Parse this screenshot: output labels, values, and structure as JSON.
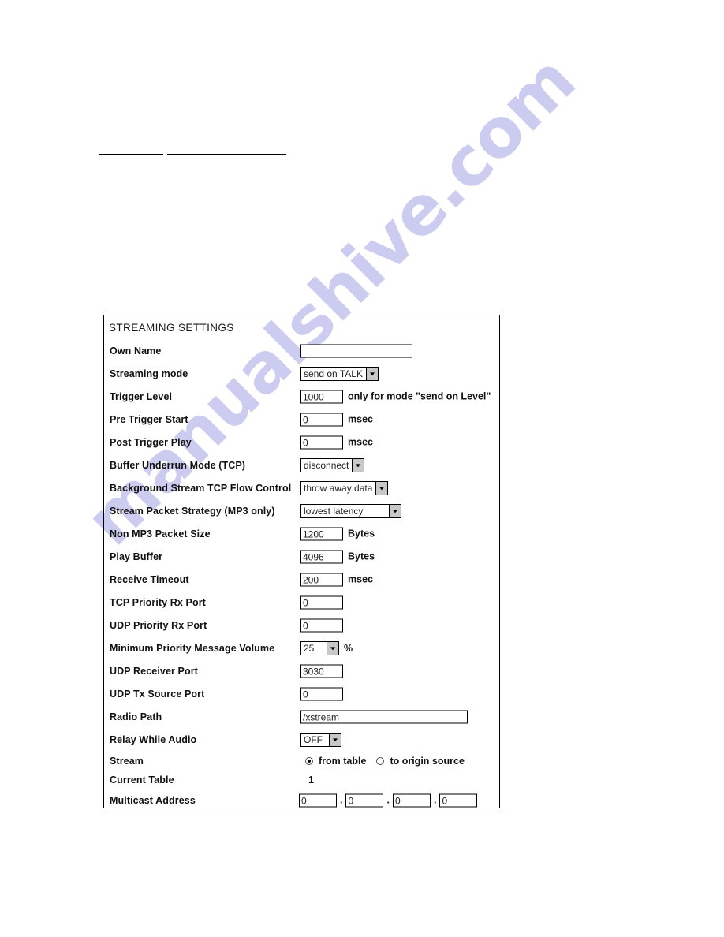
{
  "page": {
    "watermark": "manualshive.com"
  },
  "panel": {
    "title": "STREAMING SETTINGS",
    "rows": [
      {
        "label": "Own Name",
        "type": "text",
        "value": ""
      },
      {
        "label": "Streaming mode",
        "type": "select",
        "value": "send on TALK"
      },
      {
        "label": "Trigger Level",
        "type": "text",
        "value": "1000",
        "note": "only for mode \"send on Level\""
      },
      {
        "label": "Pre Trigger Start",
        "type": "text",
        "value": "0",
        "suffix": "msec"
      },
      {
        "label": "Post Trigger Play",
        "type": "text",
        "value": "0",
        "suffix": "msec"
      },
      {
        "label": "Buffer Underrun Mode (TCP)",
        "type": "select",
        "value": "disconnect"
      },
      {
        "label": "Background Stream TCP Flow Control",
        "type": "select",
        "value": "throw away data"
      },
      {
        "label": "Stream Packet Strategy (MP3 only)",
        "type": "select",
        "value": "lowest latency"
      },
      {
        "label": "Non MP3 Packet Size",
        "type": "text",
        "value": "1200",
        "suffix": "Bytes"
      },
      {
        "label": "Play Buffer",
        "type": "text",
        "value": "4096",
        "suffix": "Bytes"
      },
      {
        "label": "Receive Timeout",
        "type": "text",
        "value": "200",
        "suffix": "msec"
      },
      {
        "label": "TCP Priority Rx Port",
        "type": "text",
        "value": "0"
      },
      {
        "label": "UDP Priority Rx Port",
        "type": "text",
        "value": "0"
      },
      {
        "label": "Minimum Priority Message Volume",
        "type": "select",
        "value": "25",
        "suffix": "%"
      },
      {
        "label": "UDP Receiver Port",
        "type": "text",
        "value": "3030"
      },
      {
        "label": "UDP Tx Source Port",
        "type": "text",
        "value": "0"
      },
      {
        "label": "Radio Path",
        "type": "text",
        "value": "/xstream"
      },
      {
        "label": "Relay While Audio",
        "type": "select",
        "value": "OFF"
      },
      {
        "label": "Stream",
        "type": "radio"
      },
      {
        "label": "Current Table",
        "type": "plain",
        "value": "1"
      },
      {
        "label": "Multicast Address",
        "type": "ip"
      }
    ],
    "stream_options": [
      {
        "label": "from table",
        "selected": true
      },
      {
        "label": "to origin source",
        "selected": false
      }
    ],
    "multicast": {
      "octets": [
        "0",
        "0",
        "0",
        "0"
      ],
      "separator": "."
    }
  }
}
